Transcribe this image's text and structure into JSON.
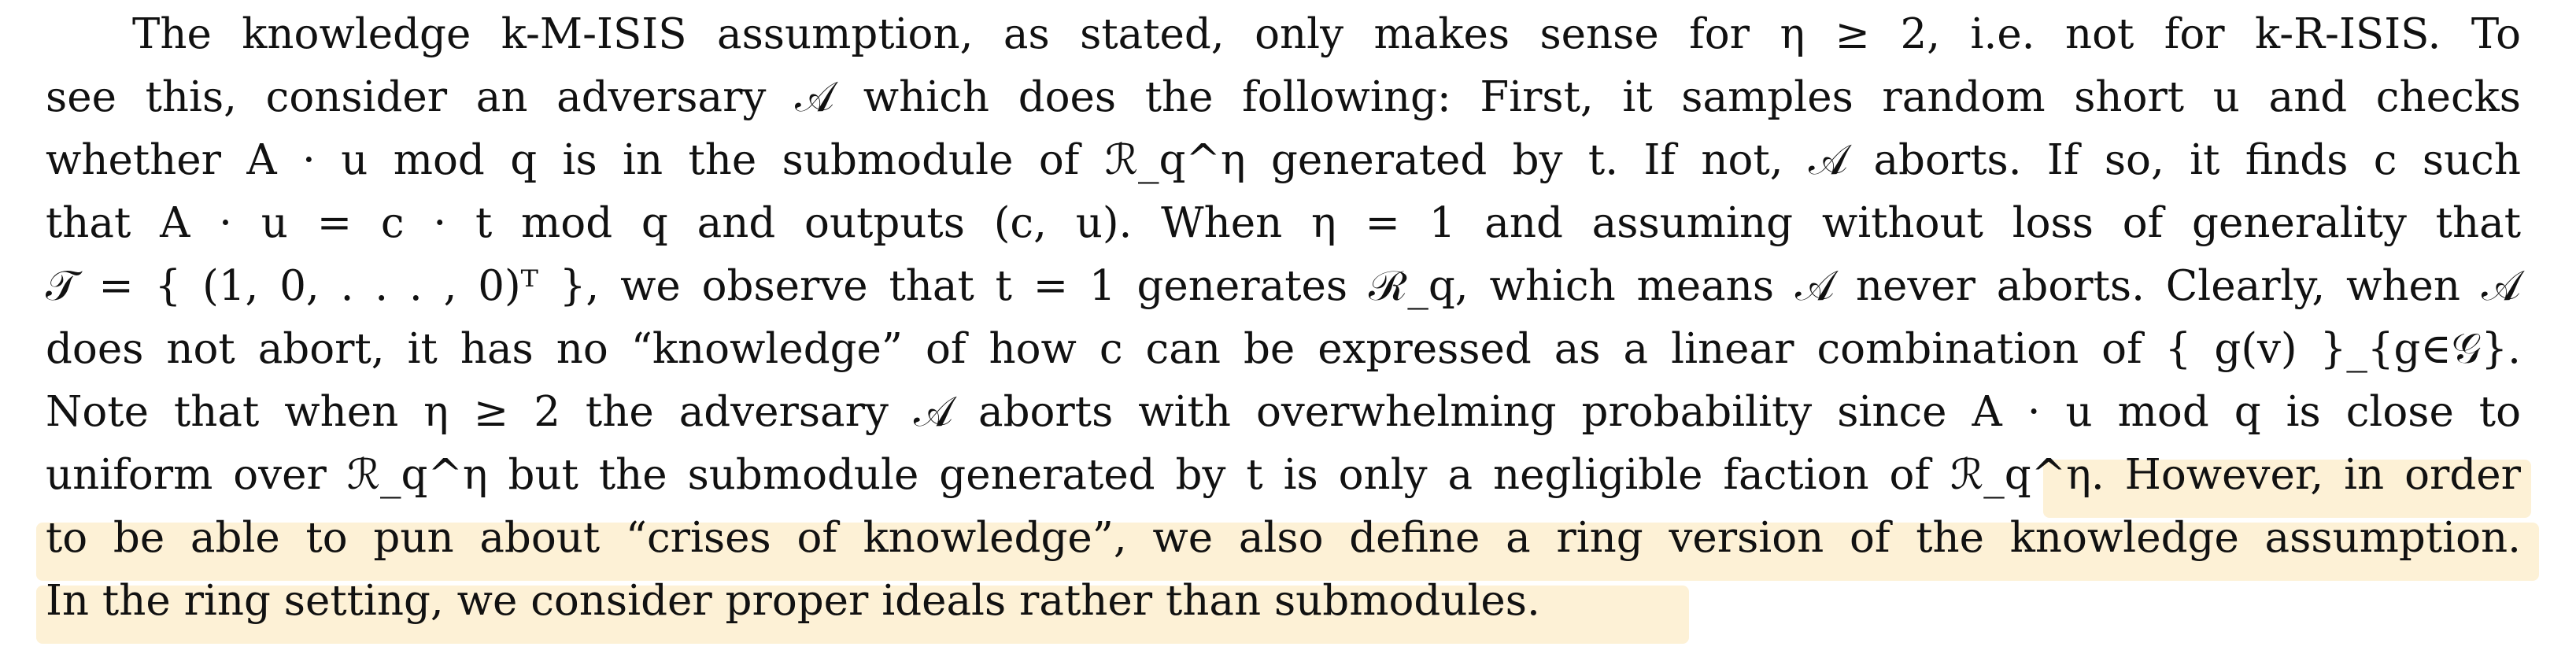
{
  "paragraph": {
    "lines": [
      "The knowledge k-M-ISIS assumption, as stated, only makes sense for η ≥ 2, i.e. not for k-R-ISIS. To",
      "see this, consider an adversary 𝒜 which does the following: First, it samples random short u and checks",
      "whether A · u mod q is in the submodule of ℛ_q^η generated by t. If not, 𝒜 aborts. If so, it finds c such",
      "that A · u = c · t mod q and outputs (c, u). When η = 1 and assuming without loss of generality that",
      "𝒯 = { (1, 0, . . . , 0)ᵀ }, we observe that t = 1 generates ℛ_q, which means 𝒜 never aborts. Clearly, when 𝒜",
      "does not abort, it has no “knowledge” of how c can be expressed as a linear combination of { g(v) }_{g∈𝒢}.",
      "Note that when η ≥ 2 the adversary 𝒜 aborts with overwhelming probability since A · u mod q is close to",
      "uniform over ℛ_q^η but the submodule generated by t is only a negligible faction of ℛ_q^η.",
      "to be able to pun about “crises of knowledge”, we also define a ring version of the knowledge assumption.",
      "In the ring setting, we consider proper ideals rather than submodules."
    ],
    "highlighted_start": "However, in order"
  },
  "colors": {
    "highlight": "#fdf1d6",
    "text": "#111111",
    "background": "#ffffff"
  }
}
